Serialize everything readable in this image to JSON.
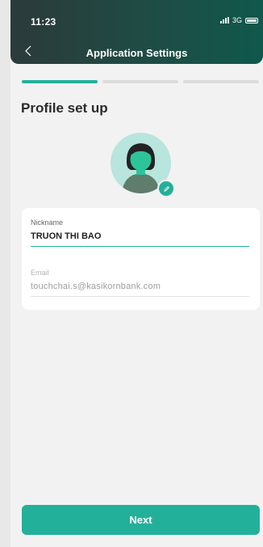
{
  "status_bar": {
    "time": "11:23",
    "network": "3G"
  },
  "header": {
    "title": "Application Settings",
    "back_icon": "chevron-left-icon"
  },
  "progress": {
    "steps_total": 3,
    "current_step": 1,
    "accent_color": "#23b09a"
  },
  "page": {
    "title": "Profile set up"
  },
  "avatar": {
    "icon": "user-avatar-icon",
    "edit_icon": "pencil-icon"
  },
  "form": {
    "nickname": {
      "label": "Nickname",
      "value": "TRUON THI BAO"
    },
    "email": {
      "label": "Email",
      "value": "touchchai.s@kasikornbank.com"
    }
  },
  "actions": {
    "next_label": "Next"
  },
  "colors": {
    "accent": "#23b09a",
    "header_dark": "#1f4c45"
  }
}
